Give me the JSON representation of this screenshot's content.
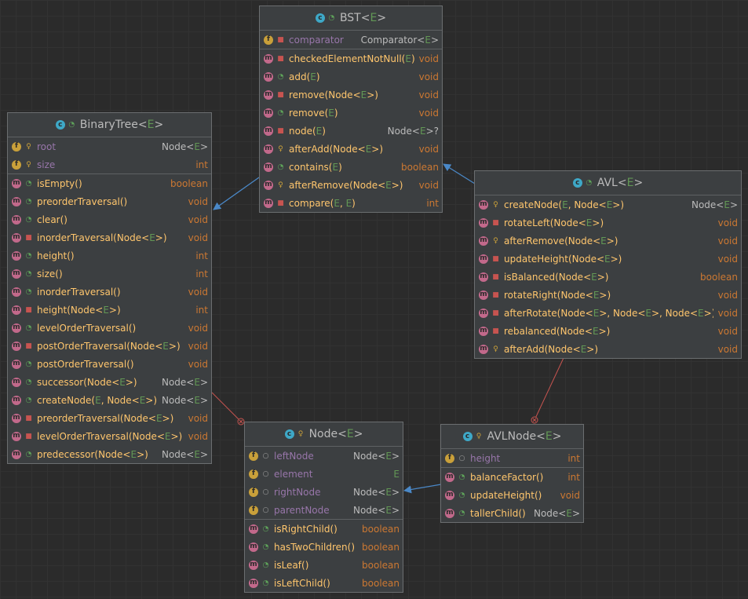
{
  "classes": {
    "bst": {
      "name": "BST",
      "type_param": "E",
      "kind": "class-icon",
      "fields": [
        {
          "name": "comparator",
          "type": "Comparator<E>",
          "vis": "private"
        }
      ],
      "methods": [
        {
          "name": "checkedElementNotNull(E)",
          "type": "void",
          "vis": "private"
        },
        {
          "name": "add(E)",
          "type": "void",
          "vis": "public"
        },
        {
          "name": "remove(Node<E>)",
          "type": "void",
          "vis": "private"
        },
        {
          "name": "remove(E)",
          "type": "void",
          "vis": "public"
        },
        {
          "name": "node(E)",
          "type": "Node<E>?",
          "vis": "private"
        },
        {
          "name": "afterAdd(Node<E>)",
          "type": "void",
          "vis": "protected"
        },
        {
          "name": "contains(E)",
          "type": "boolean",
          "vis": "public"
        },
        {
          "name": "afterRemove(Node<E>)",
          "type": "void",
          "vis": "protected"
        },
        {
          "name": "compare(E, E)",
          "type": "int",
          "vis": "private"
        }
      ]
    },
    "binarytree": {
      "name": "BinaryTree",
      "type_param": "E",
      "kind": "class-icon",
      "fields": [
        {
          "name": "root",
          "type": "Node<E>",
          "vis": "protected"
        },
        {
          "name": "size",
          "type": "int",
          "vis": "protected"
        }
      ],
      "methods": [
        {
          "name": "isEmpty()",
          "type": "boolean",
          "vis": "public"
        },
        {
          "name": "preorderTraversal()",
          "type": "void",
          "vis": "public"
        },
        {
          "name": "clear()",
          "type": "void",
          "vis": "public"
        },
        {
          "name": "inorderTraversal(Node<E>)",
          "type": "void",
          "vis": "private"
        },
        {
          "name": "height()",
          "type": "int",
          "vis": "public"
        },
        {
          "name": "size()",
          "type": "int",
          "vis": "public"
        },
        {
          "name": "inorderTraversal()",
          "type": "void",
          "vis": "public"
        },
        {
          "name": "height(Node<E>)",
          "type": "int",
          "vis": "private"
        },
        {
          "name": "levelOrderTraversal()",
          "type": "void",
          "vis": "public"
        },
        {
          "name": "postOrderTraversal(Node<E>)",
          "type": "void",
          "vis": "private"
        },
        {
          "name": "postOrderTraversal()",
          "type": "void",
          "vis": "public"
        },
        {
          "name": "successor(Node<E>)",
          "type": "Node<E>",
          "vis": "public"
        },
        {
          "name": "createNode(E, Node<E>)",
          "type": "Node<E>",
          "vis": "public"
        },
        {
          "name": "preorderTraversal(Node<E>)",
          "type": "void",
          "vis": "private"
        },
        {
          "name": "levelOrderTraversal(Node<E>)",
          "type": "void",
          "vis": "private"
        },
        {
          "name": "predecessor(Node<E>)",
          "type": "Node<E>",
          "vis": "public"
        }
      ]
    },
    "avl": {
      "name": "AVL",
      "type_param": "E",
      "kind": "class-icon",
      "fields": [],
      "methods": [
        {
          "name": "createNode(E, Node<E>)",
          "type": "Node<E>",
          "vis": "protected"
        },
        {
          "name": "rotateLeft(Node<E>)",
          "type": "void",
          "vis": "private"
        },
        {
          "name": "afterRemove(Node<E>)",
          "type": "void",
          "vis": "protected"
        },
        {
          "name": "updateHeight(Node<E>)",
          "type": "void",
          "vis": "private"
        },
        {
          "name": "isBalanced(Node<E>)",
          "type": "boolean",
          "vis": "private"
        },
        {
          "name": "rotateRight(Node<E>)",
          "type": "void",
          "vis": "private"
        },
        {
          "name": "afterRotate(Node<E>, Node<E>, Node<E>)",
          "type": "void",
          "vis": "private"
        },
        {
          "name": "rebalanced(Node<E>)",
          "type": "void",
          "vis": "private"
        },
        {
          "name": "afterAdd(Node<E>)",
          "type": "void",
          "vis": "protected"
        }
      ]
    },
    "node": {
      "name": "Node",
      "type_param": "E",
      "kind": "static-class-icon",
      "fields": [
        {
          "name": "leftNode",
          "type": "Node<E>",
          "vis": "package"
        },
        {
          "name": "element",
          "type": "E",
          "vis": "package"
        },
        {
          "name": "rightNode",
          "type": "Node<E>",
          "vis": "package"
        },
        {
          "name": "parentNode",
          "type": "Node<E>",
          "vis": "package"
        }
      ],
      "methods": [
        {
          "name": "isRightChild()",
          "type": "boolean",
          "vis": "public"
        },
        {
          "name": "hasTwoChildren()",
          "type": "boolean",
          "vis": "public"
        },
        {
          "name": "isLeaf()",
          "type": "boolean",
          "vis": "public"
        },
        {
          "name": "isLeftChild()",
          "type": "boolean",
          "vis": "public"
        }
      ]
    },
    "avlnode": {
      "name": "AVLNode",
      "type_param": "E",
      "kind": "static-class-icon",
      "fields": [
        {
          "name": "height",
          "type": "int",
          "vis": "package"
        }
      ],
      "methods": [
        {
          "name": "balanceFactor()",
          "type": "int",
          "vis": "public"
        },
        {
          "name": "updateHeight()",
          "type": "void",
          "vis": "public"
        },
        {
          "name": "tallerChild()",
          "type": "Node<E>",
          "vis": "public"
        }
      ]
    }
  },
  "colors": {
    "background": "#2b2b2b",
    "inheritance_arrow": "#4a88c7",
    "inner_class_line": "#c75450"
  }
}
